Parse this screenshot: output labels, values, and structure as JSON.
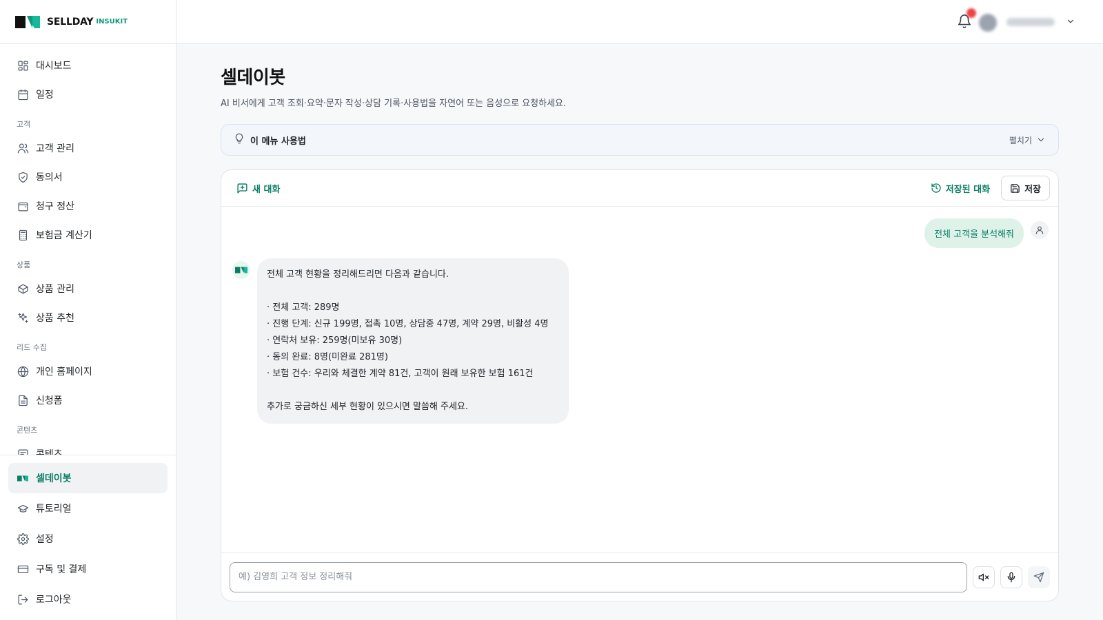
{
  "brand": {
    "name": "SELLDAY",
    "sub": "INSUKIT"
  },
  "sidebar": {
    "items": [
      {
        "type": "item",
        "label": "대시보드",
        "icon": "dashboard-icon",
        "name": "sidebar-item-dashboard"
      },
      {
        "type": "item",
        "label": "일정",
        "icon": "calendar-icon",
        "name": "sidebar-item-schedule"
      },
      {
        "type": "section",
        "label": "고객"
      },
      {
        "type": "item",
        "label": "고객 관리",
        "icon": "users-icon",
        "name": "sidebar-item-customers"
      },
      {
        "type": "item",
        "label": "동의서",
        "icon": "shield-icon",
        "name": "sidebar-item-consent"
      },
      {
        "type": "item",
        "label": "청구 정산",
        "icon": "wallet-icon",
        "name": "sidebar-item-claims"
      },
      {
        "type": "item",
        "label": "보험금 계산기",
        "icon": "calculator-icon",
        "name": "sidebar-item-calculator"
      },
      {
        "type": "section",
        "label": "상품"
      },
      {
        "type": "item",
        "label": "상품 관리",
        "icon": "box-icon",
        "name": "sidebar-item-products"
      },
      {
        "type": "item",
        "label": "상품 추천",
        "icon": "sparkles-icon",
        "name": "sidebar-item-recommend"
      },
      {
        "type": "section",
        "label": "리드 수집"
      },
      {
        "type": "item",
        "label": "개인 홈페이지",
        "icon": "globe-icon",
        "name": "sidebar-item-homepage"
      },
      {
        "type": "item",
        "label": "신청폼",
        "icon": "form-icon",
        "name": "sidebar-item-form"
      },
      {
        "type": "section",
        "label": "콘텐츠"
      },
      {
        "type": "item",
        "label": "콘텐츠",
        "icon": "content-icon",
        "name": "sidebar-item-content"
      }
    ],
    "bottom": [
      {
        "label": "셀데이봇",
        "icon": "bot-icon",
        "name": "sidebar-item-bot",
        "active": true
      },
      {
        "label": "튜토리얼",
        "icon": "graduation-icon",
        "name": "sidebar-item-tutorial",
        "active": false
      },
      {
        "label": "설정",
        "icon": "gear-icon",
        "name": "sidebar-item-settings",
        "active": false
      },
      {
        "label": "구독 및 결제",
        "icon": "card-icon",
        "name": "sidebar-item-billing",
        "active": false
      },
      {
        "label": "로그아웃",
        "icon": "logout-icon",
        "name": "sidebar-item-logout",
        "active": false
      }
    ]
  },
  "page": {
    "title": "셀데이봇",
    "description": "AI 비서에게 고객 조회·요약·문자 작성·상담 기록·사용법을 자연어 또는 음성으로 요청하세요."
  },
  "howto": {
    "title": "이 메뉴 사용법",
    "expand_label": "펼치기"
  },
  "chat": {
    "new_chat_label": "새 대화",
    "saved_label": "저장된 대화",
    "save_label": "저장",
    "user_message": "전체 고객을 분석해줘",
    "bot_message": {
      "intro": "전체 고객 현황을 정리해드리면 다음과 같습니다.",
      "lines": [
        "· 전체 고객: 289명",
        "· 진행 단계: 신규 199명, 접촉 10명, 상담중 47명, 계약 29명, 비활성 4명",
        "· 연락처 보유: 259명(미보유 30명)",
        "· 동의 완료: 8명(미완료 281명)",
        "· 보험 건수: 우리와 체결한 계약 81건, 고객이 원래 보유한 보험 161건"
      ],
      "outro": "추가로 궁금하신 세부 현황이 있으시면 말씀해 주세요."
    },
    "input_placeholder": "예) 김영희 고객 정보 정리해줘"
  },
  "colors": {
    "accent": "#0b7d64",
    "accent_light": "#dff2ea",
    "notification": "#ef4444"
  }
}
